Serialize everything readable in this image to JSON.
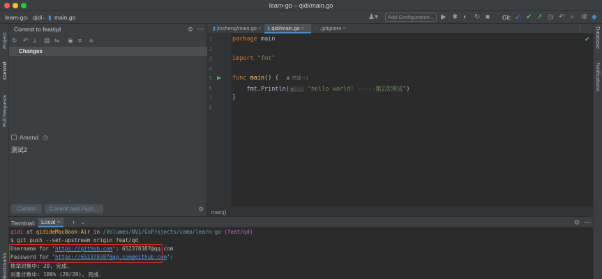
{
  "window": {
    "title": "learn-go – qidi/main.go"
  },
  "navbar": {
    "crumbs": [
      "learn-go",
      "qidi",
      "main.go"
    ],
    "add_configuration": "Add Configuration...",
    "git_label": "Git:"
  },
  "left_strip": {
    "project": "Project",
    "commit": "Commit",
    "pull_requests": "Pull Requests",
    "bookmarks": "Bookmarks"
  },
  "right_strip": {
    "database": "Database",
    "notifications": "Notifications"
  },
  "commit_panel": {
    "title": "Commit to feat/qd",
    "changes_label": "Changes",
    "amend_label": "Amend",
    "message": "测试2",
    "commit_button": "Commit",
    "commit_push_button": "Commit and Push..."
  },
  "editor": {
    "tabs": [
      {
        "label": "jincheng/main.go",
        "active": false
      },
      {
        "label": "qidi/main.go",
        "active": true
      },
      {
        "label": ".gitignore",
        "active": false
      }
    ],
    "line_numbers": [
      "1",
      "2",
      "3",
      "4",
      "5",
      "6",
      "7",
      "8"
    ],
    "code": {
      "l1_kw": "package",
      "l1_rest": " main",
      "l3_kw": "import",
      "l3_str": " \"fmt\"",
      "l5_kw": "func",
      "l5_fn": " main",
      "l5_rest": "() {",
      "l5_author": "齐迪 +1",
      "l6_pre": "    fmt.Println(",
      "l6_hint": "a...",
      "l6_str": "\"hello world! -----第2次测试\"",
      "l6_post": ")",
      "l7": "}"
    },
    "footer": "main()"
  },
  "terminal": {
    "label": "Terminal:",
    "tab": "Local",
    "prompt_user": "qidi",
    "prompt_at": " at ",
    "prompt_host": "qididеMacBook-Air",
    "prompt_in": " in ",
    "prompt_path": "/Volumes/NV1/GoProjects/camp/learn-go",
    "prompt_branch": " (feat/qd)",
    "cmd": "$ git push --set-upstream origin feat/qd",
    "username_pre": "Username for '",
    "username_url": "https://github.com",
    "username_post": "': 652378387@qq.com",
    "password_pre": "Password for '",
    "password_url": "https://652378387@qq.com@github.com",
    "password_post": "':",
    "enum_line": "枚举对象中: 20, 完成.",
    "count_line": "对象计数中: 100% (20/20), 完成."
  },
  "colors": {
    "accent": "#4a88c7",
    "highlight_box": "#d8282a",
    "keyword": "#cc7832",
    "string": "#6a8759"
  }
}
